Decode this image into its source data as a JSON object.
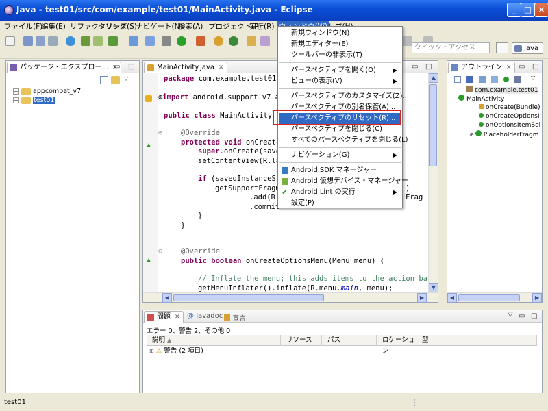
{
  "window": {
    "title": "Java - test01/src/com/example/test01/MainActivity.java - Eclipse"
  },
  "menubar": [
    "ファイル(F)",
    "編集(E)",
    "リファクタリング",
    "ソース(S)",
    "ナビゲート(N)",
    "検索(A)",
    "プロジェクト(P)",
    "実行(R)",
    "ウィンドウ(W)",
    "ヘルプ(H)"
  ],
  "toolbar": {
    "quick_access_placeholder": "クイック・アクセス",
    "perspective": "Java"
  },
  "package_explorer": {
    "tab": "パッケージ・エクスプロー...",
    "items": [
      "appcompat_v7",
      "test01"
    ]
  },
  "editor": {
    "tab": "MainActivity.java",
    "lines": [
      "package com.example.test01;",
      "import android.support.v7.a",
      "public class MainActivity e",
      "@Override",
      "protected void onCreate(",
      "super.onCreate(save",
      "setContentView(R.la",
      "if (savedInstanceSt",
      "getSupportFragm",
      ".add(R.",
      ".commit",
      "}",
      "}",
      "@Override",
      "public boolean onCreateOptionsMenu(Menu menu) {",
      "// Inflate the menu; this adds items to the action ba",
      "getMenuInflater().inflate(R.menu.main, menu);",
      ")",
      "Frag"
    ]
  },
  "outline": {
    "tab": "アウトライン",
    "items": [
      "com.example.test01",
      "MainActivity",
      "onCreate(Bundle)",
      "onCreateOptionsI",
      "onOptionsItemSel",
      "PlaceholderFragm"
    ]
  },
  "problems": {
    "tabs": [
      "問題",
      "Javadoc",
      "宣言"
    ],
    "summary": "エラー 0、警告 2、その他 0",
    "columns": [
      "説明",
      "リソース",
      "パス",
      "ロケーション",
      "型"
    ],
    "rows": [
      {
        "description": "警告 (2 項目)"
      }
    ]
  },
  "window_menu": {
    "items": [
      "新規ウィンドウ(N)",
      "新規エディター(E)",
      "ツールバーの非表示(T)",
      "パースペクティブを開く(O)",
      "ビューの表示(V)",
      "パースペクティブのカスタマイズ(Z)...",
      "パースペクティブの別名保管(A)...",
      "パースペクティブのリセット(R)...",
      "パースペクティブを閉じる(C)",
      "すべてのパースペクティブを閉じる(L)",
      "ナビゲーション(G)",
      "Android SDK マネージャー",
      "Android 仮想デバイス・マネージャー",
      "Android Lint の実行",
      "設定(P)"
    ],
    "highlighted": "パースペクティブのリセット(R)..."
  },
  "statusbar": {
    "text": "test01"
  },
  "colors": {
    "title_bar": "#0b4fd6",
    "menu_highlight": "#316ac5",
    "callout": "#e0201c"
  }
}
